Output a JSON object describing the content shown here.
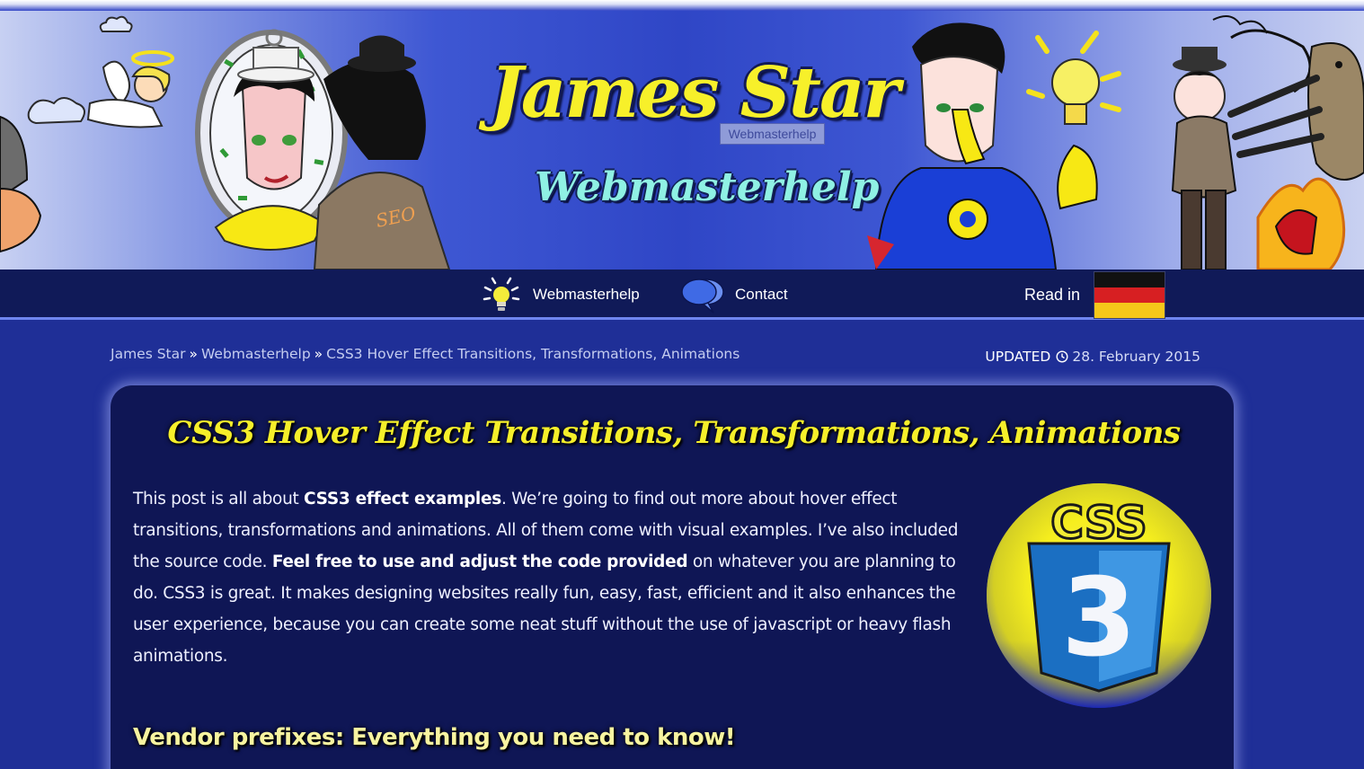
{
  "banner": {
    "title": "James Star",
    "subtitle": "Webmasterhelp",
    "tooltip": "Webmasterhelp",
    "shirt_text": "SEO"
  },
  "nav": {
    "items": [
      {
        "label": "Webmasterhelp",
        "icon": "lightbulb-icon"
      },
      {
        "label": "Contact",
        "icon": "speech-bubbles-icon"
      }
    ],
    "read_in_label": "Read in",
    "language_flag": "german-flag-icon"
  },
  "breadcrumb": {
    "items": [
      "James Star",
      "Webmasterhelp",
      "CSS3 Hover Effect Transitions, Transformations, Animations"
    ],
    "separator": "»"
  },
  "updated": {
    "label": "UPDATED",
    "date": "28. February 2015"
  },
  "article": {
    "title": "CSS3 Hover Effect Transitions, Transformations, Animations",
    "intro": {
      "t1": "This post is all about ",
      "b1": "CSS3 effect examples",
      "t2": ". We’re going to find out more about hover effect transitions, transformations and animations. All of them come with visual examples. I’ve also included the source code. ",
      "b2": "Feel free to use and adjust the code provided",
      "t3": " on whatever you are planning to do. CSS3 is great. It makes designing websites really fun, easy, fast, efficient and it also enhances the user experience, because you can create some neat stuff without the use of javascript or heavy flash animations."
    },
    "logo_text": "CSS",
    "logo_number": "3",
    "section_heading": "Vendor prefixes: Everything you need to know!"
  },
  "colors": {
    "page_bg": "#1f2f97",
    "nav_bg": "#101a58",
    "card_bg": "#0f1655",
    "title_yellow": "#f6ef2a",
    "heading_yellow": "#f8f4a0"
  }
}
